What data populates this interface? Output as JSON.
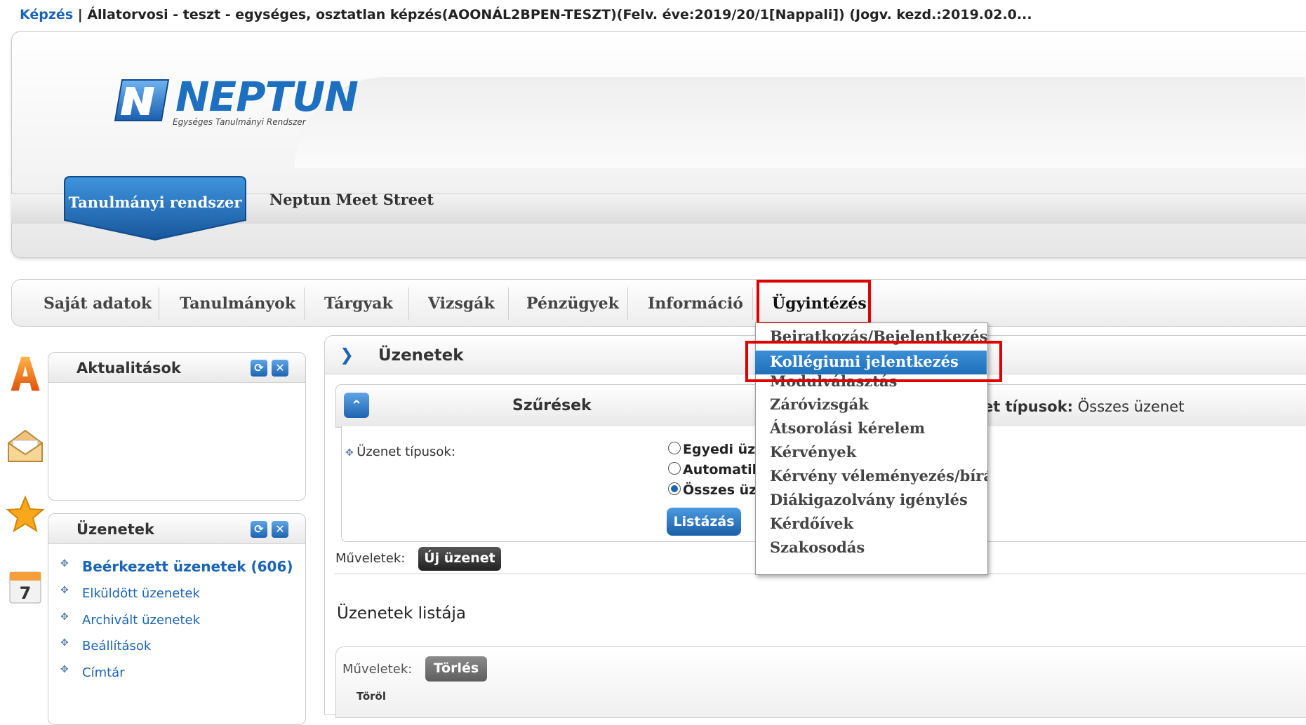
{
  "topline": {
    "link": "Képzés",
    "separator": " | ",
    "text": "Állatorvosi - teszt - egységes, osztatlan képzés(AOONÁL2BPEN-TESZT)(Felv. éve:2019/20/1[Nappali]) (Jogv. kezd.:2019.02.0..."
  },
  "logo": {
    "title": "NEPTUN",
    "subtitle": "Egységes Tanulmányi Rendszer"
  },
  "subnav": {
    "active": "Tanulmányi rendszer",
    "other": "Neptun Meet Street"
  },
  "mainmenu": {
    "items": [
      "Saját adatok",
      "Tanulmányok",
      "Tárgyak",
      "Vizsgák",
      "Pénzügyek",
      "Információ",
      "Ügyintézés"
    ]
  },
  "dropdown": {
    "items": [
      "Beiratkozás/Bejelentkezés",
      "Kollégiumi jelentkezés",
      "Modulválasztás",
      "Záróvizsgák",
      "Átsorolási kérelem",
      "Kérvények",
      "Kérvény véleményezés/bírálás",
      "Diákigazolvány igénylés",
      "Kérdőívek",
      "Szakosodás"
    ],
    "selected_index": 1
  },
  "sidebar": {
    "aktualitasok": {
      "title": "Aktualitások"
    },
    "uzenetek": {
      "title": "Üzenetek",
      "links": [
        "Beérkezett üzenetek (606)",
        "Elküldött üzenetek",
        "Archivált üzenetek",
        "Beállítások",
        "Címtár"
      ]
    }
  },
  "panel": {
    "title": "Üzenetek",
    "filter": {
      "title": "Szűrések",
      "types_label_bold": "Üzenet típusok:",
      "types_value": " Összes üzenet",
      "types_prefix_visible": "net típusok:",
      "field_label": "Üzenet típusok:",
      "options": [
        "Egyedi üz",
        "Automatil",
        "Összes üz"
      ],
      "selected_index": 2,
      "list_button": "Listázás"
    },
    "ops_label": "Műveletek:",
    "new_message": "Új üzenet",
    "list_title": "Üzenetek listája",
    "delete_button": "Törlés",
    "col_torol": "Töröl"
  },
  "colors": {
    "accent": "#1d64b0",
    "highlight": "#e00000",
    "link": "#1a64b4"
  }
}
